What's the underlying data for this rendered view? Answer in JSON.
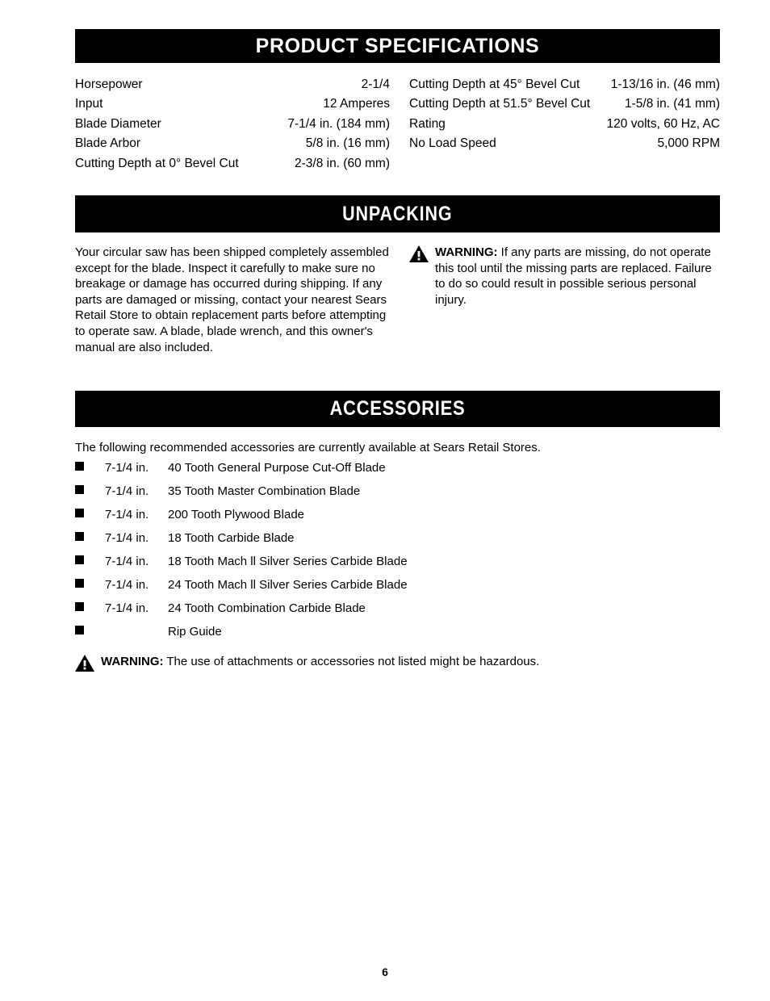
{
  "page": {
    "number": "6"
  },
  "sections": {
    "specifications": {
      "title": "PRODUCT SPECIFICATIONS",
      "left_rows": [
        {
          "label": "Horsepower",
          "value": "2-1/4"
        },
        {
          "label": "Input",
          "value": "12 Amperes"
        },
        {
          "label": "Blade Diameter",
          "value": "7-1/4  in. (184 mm)"
        },
        {
          "label": "Blade Arbor",
          "value": "5/8 in. (16 mm)"
        },
        {
          "label": "Cutting Depth at 0° Bevel Cut",
          "value": "2-3/8 in. (60 mm)"
        }
      ],
      "right_rows": [
        {
          "label": "Cutting Depth at 45° Bevel Cut",
          "value": "1-13/16 in. (46 mm)"
        },
        {
          "label": "Cutting Depth at 51.5° Bevel Cut",
          "value": "1-5/8 in. (41 mm)"
        },
        {
          "label": "Rating",
          "value": "120 volts, 60 Hz, AC"
        },
        {
          "label": "No Load Speed",
          "value": "5,000 RPM"
        }
      ]
    },
    "unpacking": {
      "title": "UNPACKING",
      "paragraph": "Your circular saw has been shipped completely assembled except for the blade. Inspect it carefully to make sure no breakage or damage has occurred during shipping. If any parts are damaged or missing, contact your nearest Sears Retail Store to obtain replacement parts before attempting to operate saw. A blade, blade wrench, and this owner's manual are also included.",
      "warning": {
        "icon": "warning-triangle-icon",
        "word": "WARNING:",
        "text": " If any parts are missing, do not operate this tool until the missing parts are replaced. Failure to do so could result in possible serious personal injury."
      }
    },
    "accessories": {
      "title": "ACCESSORIES",
      "intro": "The following recommended accessories are currently available at Sears Retail Stores.",
      "items": [
        {
          "size": "7-1/4  in.",
          "description": "40 Tooth General Purpose Cut-Off Blade"
        },
        {
          "size": "7-1/4  in.",
          "description": "35 Tooth Master Combination Blade"
        },
        {
          "size": "7-1/4  in.",
          "description": "200 Tooth Plywood Blade"
        },
        {
          "size": "7-1/4  in.",
          "description": "18 Tooth Carbide Blade"
        },
        {
          "size": "7-1/4  in.",
          "description": "18 Tooth Mach ll Silver Series Carbide Blade"
        },
        {
          "size": "7-1/4  in.",
          "description": "24 Tooth Mach ll Silver Series Carbide Blade"
        },
        {
          "size": "7-1/4  in.",
          "description": "24 Tooth Combination Carbide Blade"
        },
        {
          "size": "",
          "description": "Rip Guide"
        }
      ],
      "warning": {
        "icon": "warning-triangle-icon",
        "word": "WARNING:",
        "text": " The use of attachments or accessories not listed might be hazardous."
      }
    }
  },
  "colors": {
    "bar_background": "#000000",
    "bar_text": "#ffffff",
    "body_text": "#000000",
    "page_background": "#ffffff"
  }
}
